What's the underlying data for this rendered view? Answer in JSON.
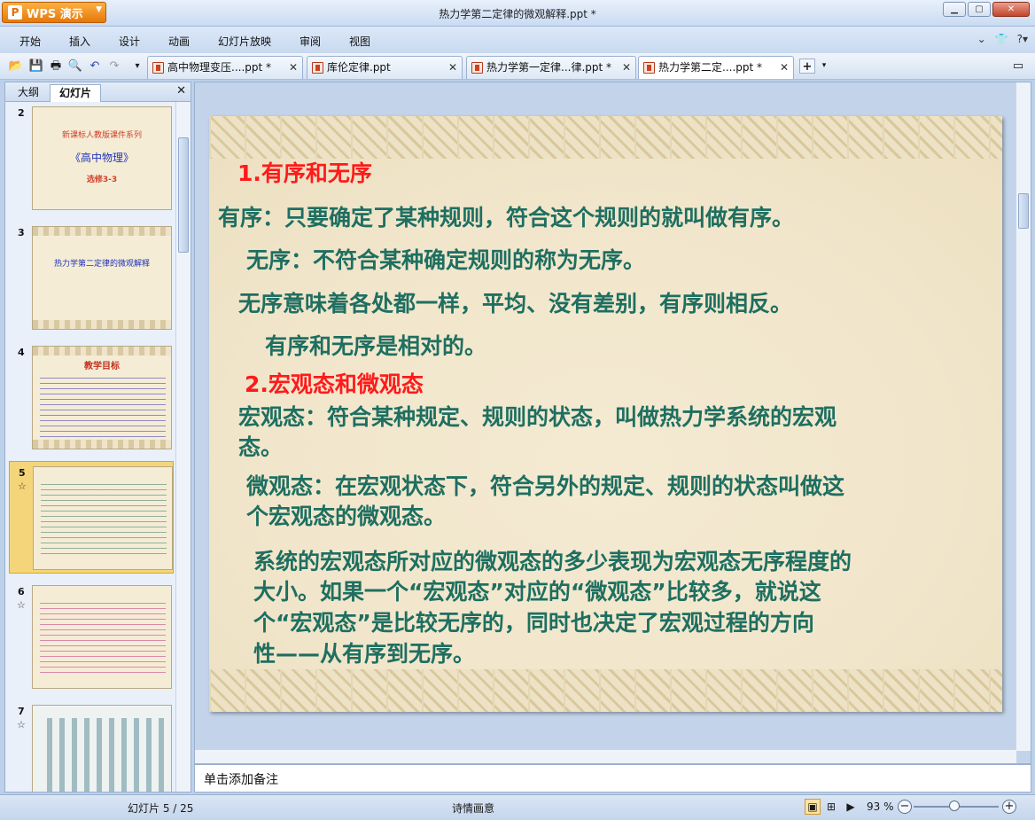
{
  "app": {
    "name": "WPS 演示",
    "title": "热力学第二定律的微观解释.ppt *"
  },
  "menu": [
    "开始",
    "插入",
    "设计",
    "动画",
    "幻灯片放映",
    "审阅",
    "视图"
  ],
  "doc_tabs": [
    {
      "label": "高中物理变压....ppt *",
      "active": false
    },
    {
      "label": "库伦定律.ppt",
      "active": false
    },
    {
      "label": "热力学第一定律...律.ppt *",
      "active": false
    },
    {
      "label": "热力学第二定....ppt *",
      "active": true
    }
  ],
  "left_panel": {
    "tabs": [
      "大纲",
      "幻灯片"
    ],
    "active_tab": "幻灯片"
  },
  "thumbnails": [
    {
      "num": "2",
      "line1": "新课标人教版课件系列",
      "line2": "《高中物理》",
      "line3": "选修3-3"
    },
    {
      "num": "3",
      "line1": "热力学第二定律的微观解释"
    },
    {
      "num": "4",
      "title": "教学目标"
    },
    {
      "num": "5",
      "selected": true
    },
    {
      "num": "6"
    },
    {
      "num": "7"
    }
  ],
  "slide": {
    "heading1": "1.有序和无序",
    "p1": "有序：只要确定了某种规则，符合这个规则的就叫做有序。",
    "p2": "无序：不符合某种确定规则的称为无序。",
    "p3": "无序意味着各处都一样，平均、没有差别，有序则相反。",
    "p4": "有序和无序是相对的。",
    "heading2": "2.宏观态和微观态",
    "p5a": "宏观态：符合某种规定、规则的状态，叫做热力学系统的宏观",
    "p5b": "态。",
    "p6a": "微观态：在宏观状态下，符合另外的规定、规则的状态叫做这",
    "p6b": "个宏观态的微观态。",
    "p7a": "系统的宏观态所对应的微观态的多少表现为宏观态无序程度的",
    "p7b": "大小。如果一个“宏观态”对应的“微观态”比较多，就说这",
    "p7c": "个“宏观态”是比较无序的，同时也决定了宏观过程的方向",
    "p7d": "性——从有序到无序。"
  },
  "notes_placeholder": "单击添加备注",
  "status": {
    "slide_counter": "幻灯片 5 / 25",
    "theme": "诗情画意",
    "zoom": "93 %"
  }
}
